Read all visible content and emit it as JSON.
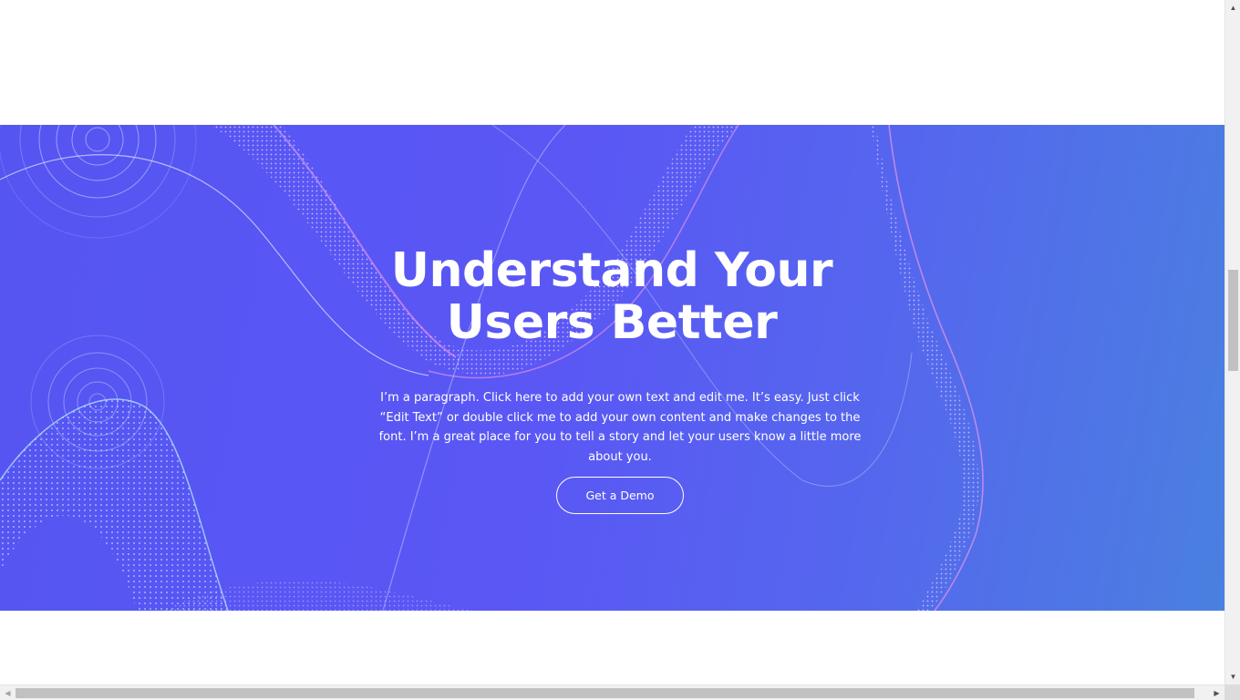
{
  "hero": {
    "title_line1": "Understand Your",
    "title_line2": "Users Better",
    "paragraph": "I’m a paragraph. Click here to add your own text and edit me. It’s easy. Just click “Edit Text” or double click me to add your own content and make changes to the font. I’m a great place for you to tell a story and let your users know a little more about you.",
    "cta_label": "Get a Demo"
  },
  "scrollbars": {
    "vertical": {
      "up_icon": "▲",
      "down_icon": "▼",
      "position": 0.4
    },
    "horizontal": {
      "left_icon": "◀",
      "right_icon": "▶",
      "position": 0.0
    }
  },
  "colors": {
    "hero_background": "#5757f4",
    "hero_background_end": "#4a80e0",
    "text": "#ffffff",
    "button_border": "#ffffff"
  }
}
